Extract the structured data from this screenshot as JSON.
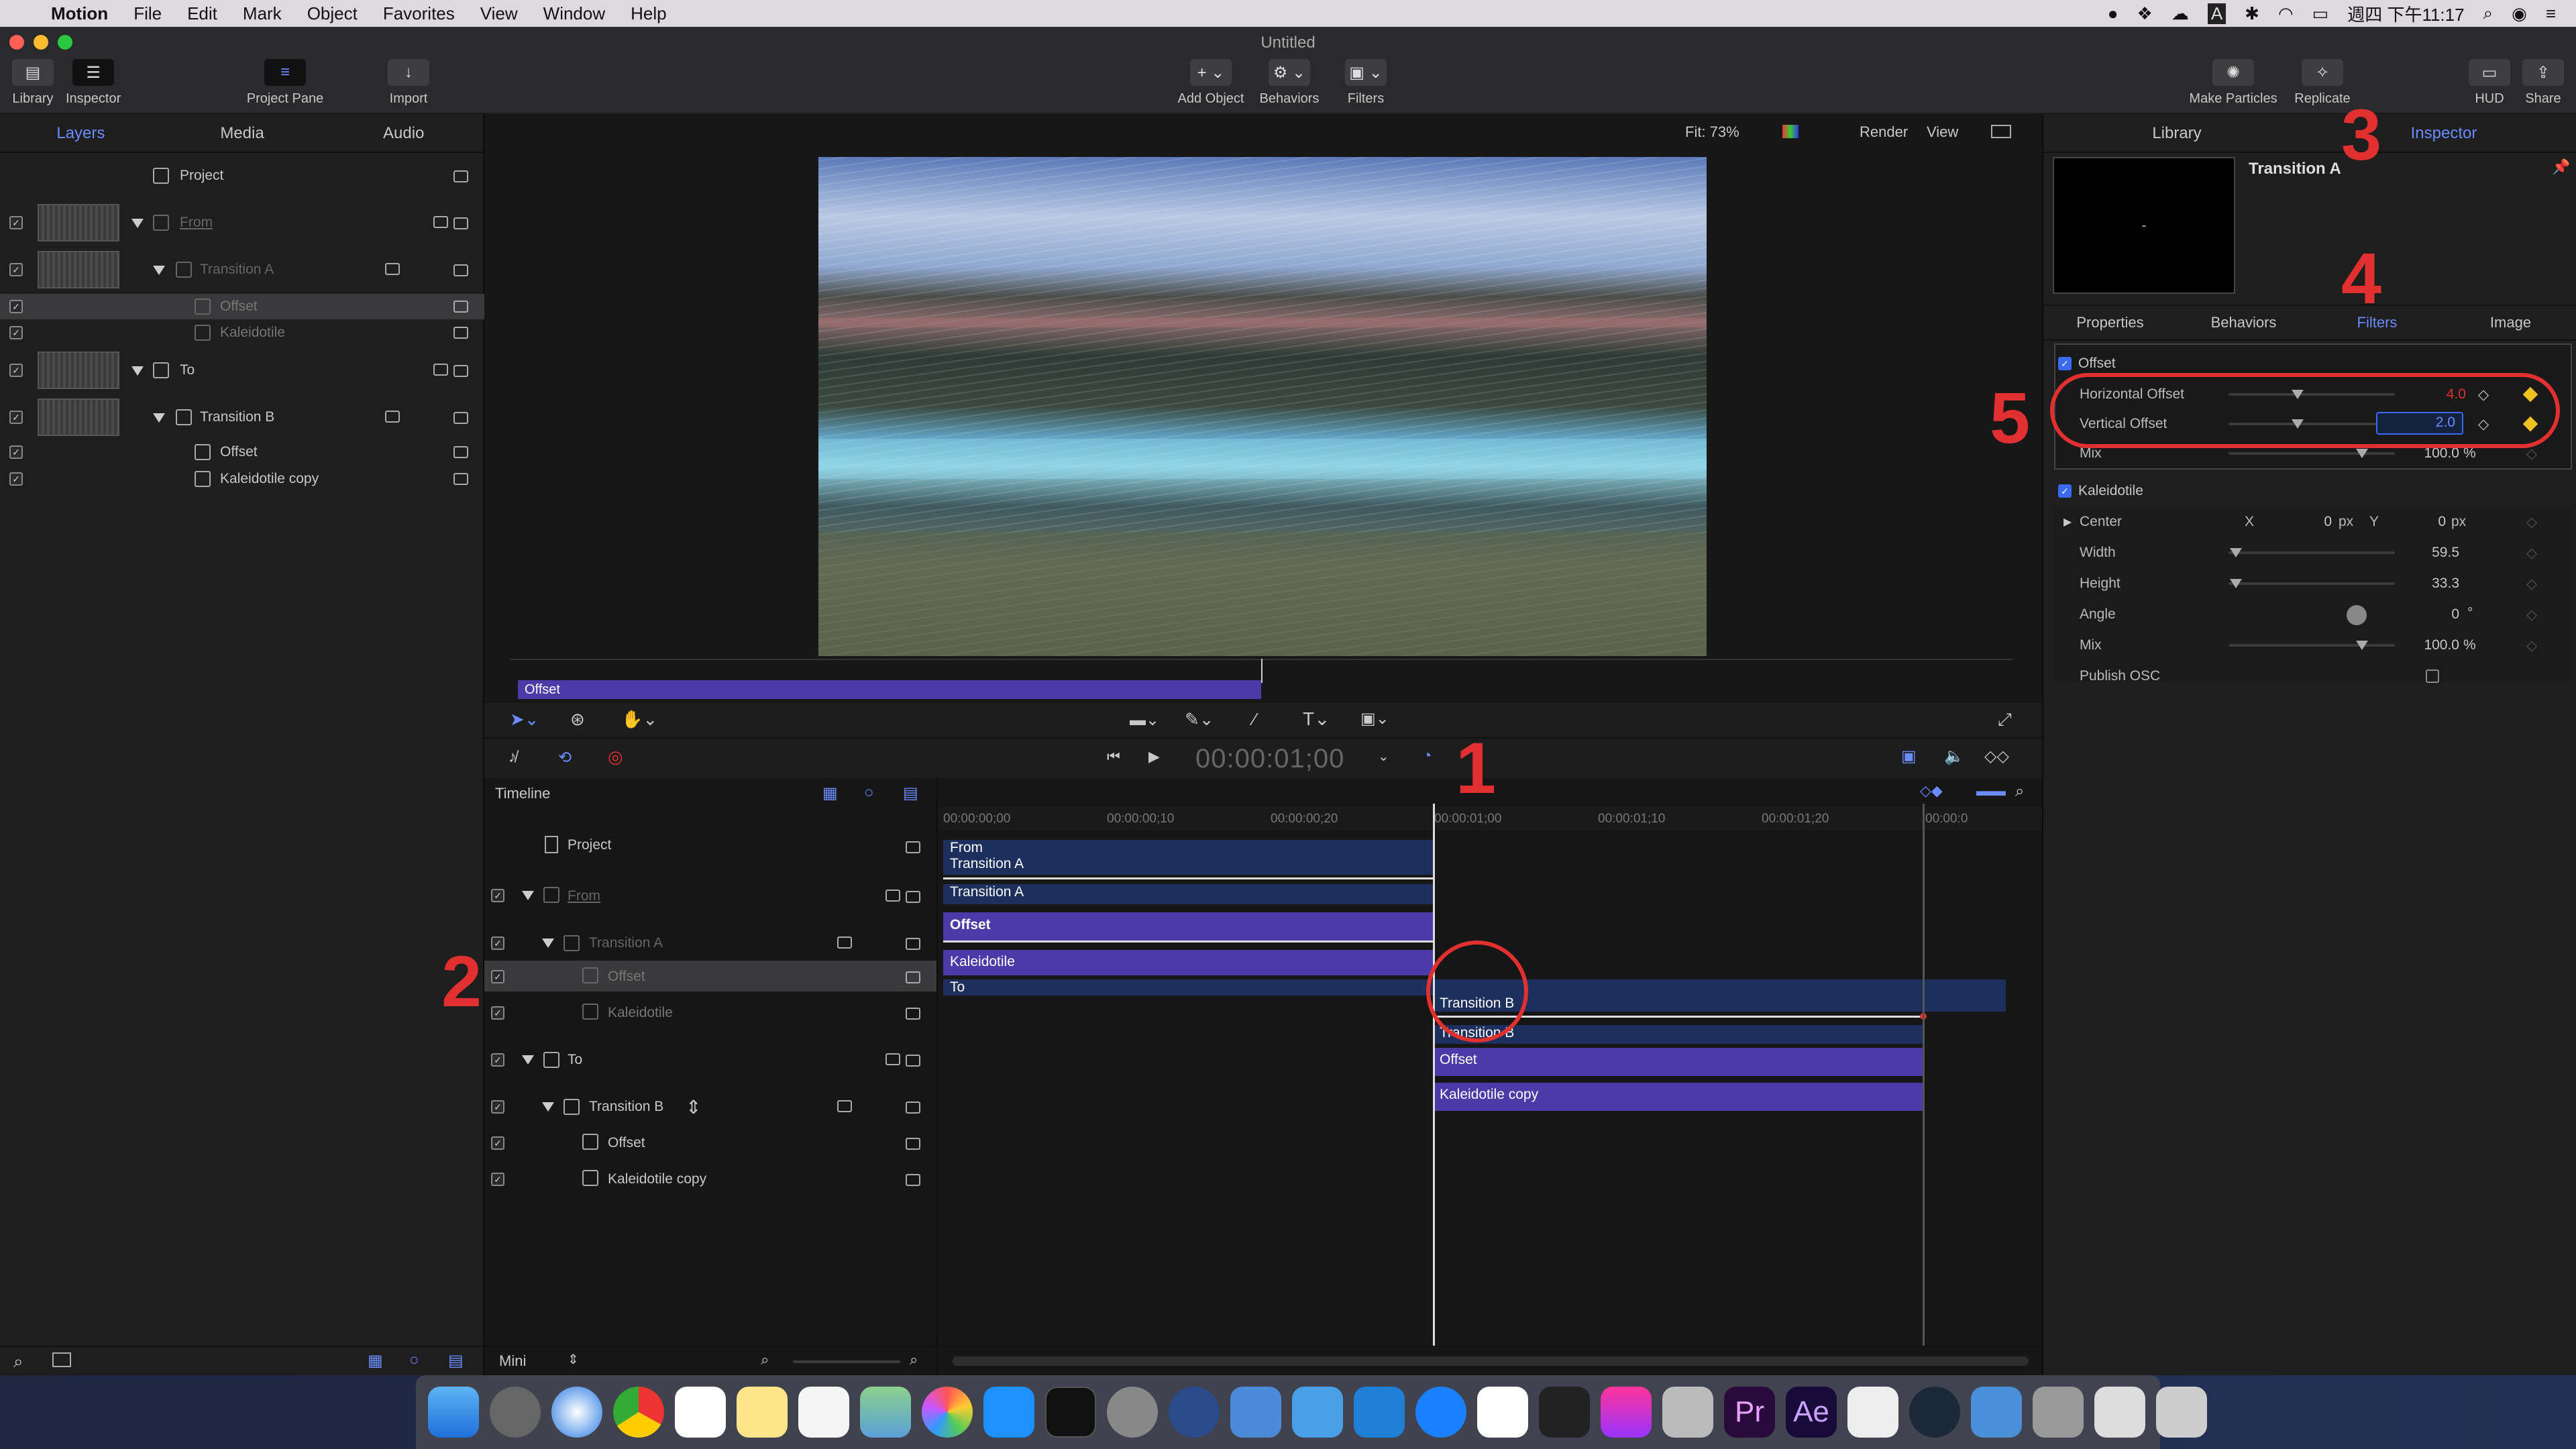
{
  "menubar": {
    "app": "Motion",
    "items": [
      "File",
      "Edit",
      "Mark",
      "Object",
      "Favorites",
      "View",
      "Window",
      "Help"
    ],
    "clock": "週四 下午11:17"
  },
  "window": {
    "title": "Untitled"
  },
  "toolbar": {
    "library": "Library",
    "inspector": "Inspector",
    "project_pane": "Project Pane",
    "import": "Import",
    "add_object": "Add Object",
    "behaviors": "Behaviors",
    "filters": "Filters",
    "make_particles": "Make Particles",
    "replicate": "Replicate",
    "hud": "HUD",
    "share": "Share"
  },
  "left_tabs": [
    "Layers",
    "Media",
    "Audio"
  ],
  "layers": [
    {
      "label": "Project"
    },
    {
      "label": "From"
    },
    {
      "label": "Transition A"
    },
    {
      "label": "Offset"
    },
    {
      "label": "Kaleidotile"
    },
    {
      "label": "To"
    },
    {
      "label": "Transition B"
    },
    {
      "label": "Offset"
    },
    {
      "label": "Kaleidotile copy"
    }
  ],
  "canvas_bar": {
    "fit": "Fit: 73%",
    "render": "Render",
    "view": "View"
  },
  "mini_timeline_bar": "Offset",
  "transport": {
    "timecode": "00:00:01;00"
  },
  "timeline": {
    "title": "Timeline",
    "ruler": [
      "00:00:00;00",
      "00:00:00;10",
      "00:00:00;20",
      "00:00:01;00",
      "00:00:01;10",
      "00:00:01;20",
      "00:00:0"
    ],
    "layers": [
      "Project",
      "From",
      "Transition A",
      "Offset",
      "Kaleidotile",
      "To",
      "Transition B",
      "Offset",
      "Kaleidotile copy"
    ],
    "bars": {
      "from": "From",
      "ta1": "Transition A",
      "ta2": "Transition A",
      "offset": "Offset",
      "kal": "Kaleidotile",
      "to": "To",
      "tb1": "Transition B",
      "tb2": "Transition B",
      "offset2": "Offset",
      "kal2": "Kaleidotile copy"
    },
    "footer": "Mini"
  },
  "inspector": {
    "top_tabs": [
      "Library",
      "Inspector"
    ],
    "object_name": "Transition A",
    "thumb_text": "-",
    "tabs": [
      "Properties",
      "Behaviors",
      "Filters",
      "Image"
    ],
    "offset_section": "Offset",
    "h_offset_label": "Horizontal Offset",
    "h_offset_val": "4.0",
    "v_offset_label": "Vertical Offset",
    "v_offset_val": "2.0",
    "mix_label": "Mix",
    "mix_val": "100.0",
    "pct": "%",
    "kal_section": "Kaleidotile",
    "center_label": "Center",
    "cx_label": "X",
    "cx_val": "0",
    "px1": "px",
    "cy_label": "Y",
    "cy_val": "0",
    "px2": "px",
    "width_label": "Width",
    "width_val": "59.5",
    "height_label": "Height",
    "height_val": "33.3",
    "angle_label": "Angle",
    "angle_val": "0",
    "deg": "°",
    "mix2_label": "Mix",
    "mix2_val": "100.0",
    "pct2": "%",
    "osc_label": "Publish OSC"
  },
  "annotations": [
    "1",
    "2",
    "3",
    "4",
    "5"
  ],
  "colors": {
    "accent": "#6b8cff",
    "clip": "#4b3aa8",
    "group": "#1f3566",
    "annotation": "#e23030",
    "keyframe": "#f0c020"
  }
}
